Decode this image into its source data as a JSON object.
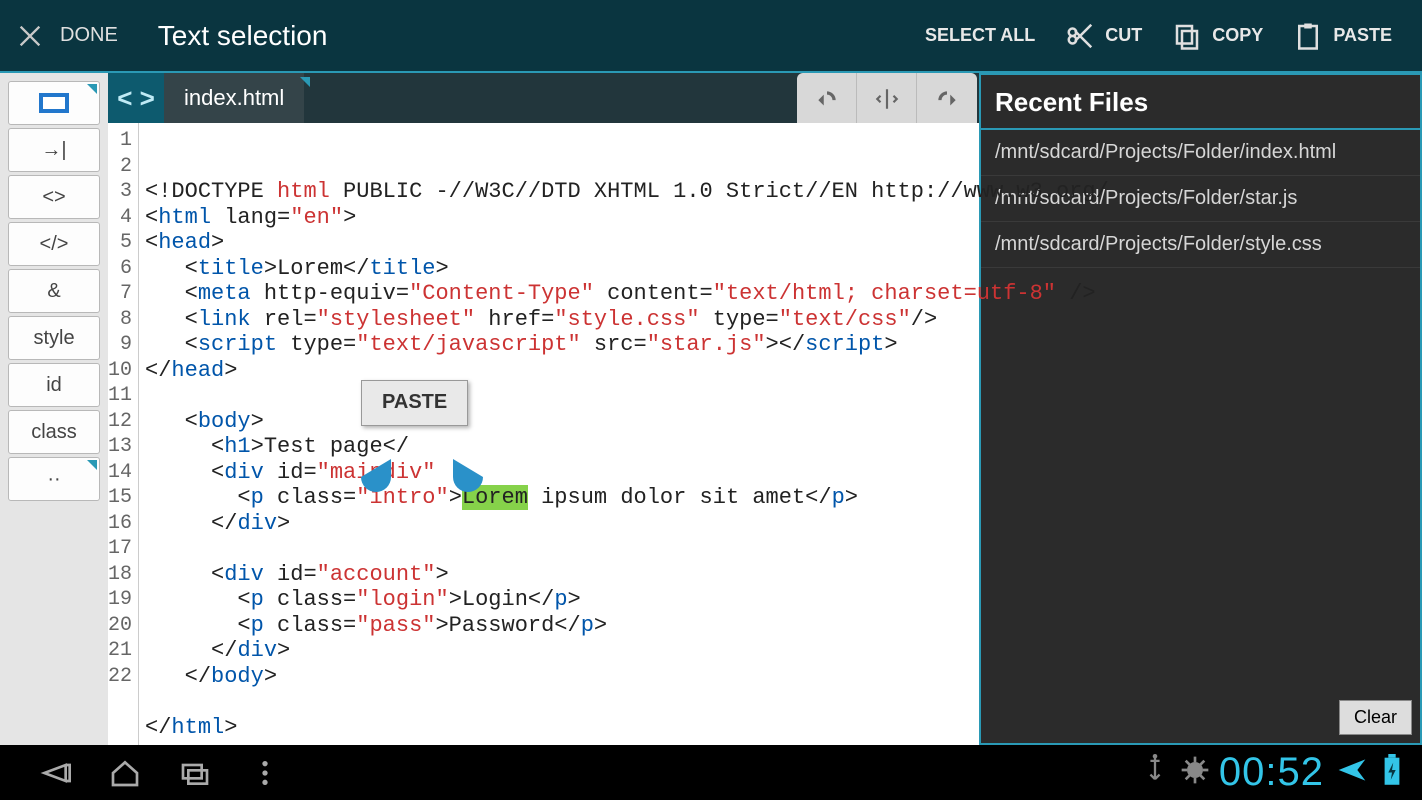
{
  "actionbar": {
    "done": "DONE",
    "title": "Text selection",
    "select_all": "SELECT ALL",
    "cut": "CUT",
    "copy": "COPY",
    "paste": "PASTE"
  },
  "left_toolbar": {
    "tab_indent": "→|",
    "angle": "<>",
    "closetag": "</>",
    "amp": "&",
    "style": "style",
    "id": "id",
    "class": "class",
    "more": "··"
  },
  "tab": {
    "filename": "index.html"
  },
  "paste_popup": "PASTE",
  "recent": {
    "title": "Recent Files",
    "items": [
      "/mnt/sdcard/Projects/Folder/index.html",
      "/mnt/sdcard/Projects/Folder/star.js",
      "/mnt/sdcard/Projects/Folder/style.css"
    ],
    "clear": "Clear"
  },
  "statusbar": {
    "time": "00:52"
  },
  "code": {
    "lines": [
      {
        "n": 1,
        "html": "&lt;!DOCTYPE <span class='kw'>html</span> PUBLIC -//W3C//DTD XHTML 1.0 Strict//EN http://www.w3.org/"
      },
      {
        "n": 2,
        "html": "&lt;<span class='tag'>html</span> lang=<span class='string'>\"en\"</span>&gt;"
      },
      {
        "n": 3,
        "html": "&lt;<span class='tag'>head</span>&gt;"
      },
      {
        "n": 4,
        "html": "   &lt;<span class='tag'>title</span>&gt;Lorem&lt;/<span class='tag'>title</span>&gt;"
      },
      {
        "n": 5,
        "html": "   &lt;<span class='tag'>meta</span> http-equiv=<span class='string'>\"Content-Type\"</span> content=<span class='string'>\"text/html; charset=utf-8\"</span> /&gt;"
      },
      {
        "n": 6,
        "html": "   &lt;<span class='tag'>link</span> rel=<span class='string'>\"stylesheet\"</span> href=<span class='string'>\"style.css\"</span> type=<span class='string'>\"text/css\"</span>/&gt;"
      },
      {
        "n": 7,
        "html": "   &lt;<span class='tag'>script</span> type=<span class='string'>\"text/javascript\"</span> src=<span class='string'>\"star.js\"</span>&gt;&lt;/<span class='tag'>script</span>&gt;"
      },
      {
        "n": 8,
        "html": "&lt;/<span class='tag'>head</span>&gt;"
      },
      {
        "n": 9,
        "html": ""
      },
      {
        "n": 10,
        "html": "   &lt;<span class='tag'>body</span>&gt;"
      },
      {
        "n": 11,
        "html": "     &lt;<span class='tag'>h1</span>&gt;Test page&lt;/"
      },
      {
        "n": 12,
        "html": "     &lt;<span class='tag'>div</span> id=<span class='string'>\"maindiv\"</span>"
      },
      {
        "n": 13,
        "html": "       &lt;<span class='tag'>p</span> class=<span class='string'>\"intro\"</span>&gt;<span class='sel'>Lorem</span> ipsum dolor sit amet&lt;/<span class='tag'>p</span>&gt;"
      },
      {
        "n": 14,
        "html": "     &lt;/<span class='tag'>div</span>&gt;"
      },
      {
        "n": 15,
        "html": ""
      },
      {
        "n": 16,
        "html": "     &lt;<span class='tag'>div</span> id=<span class='string'>\"account\"</span>&gt;"
      },
      {
        "n": 17,
        "html": "       &lt;<span class='tag'>p</span> class=<span class='string'>\"login\"</span>&gt;Login&lt;/<span class='tag'>p</span>&gt;"
      },
      {
        "n": 18,
        "html": "       &lt;<span class='tag'>p</span> class=<span class='string'>\"pass\"</span>&gt;Password&lt;/<span class='tag'>p</span>&gt;"
      },
      {
        "n": 19,
        "html": "     &lt;/<span class='tag'>div</span>&gt;"
      },
      {
        "n": 20,
        "html": "   &lt;/<span class='tag'>body</span>&gt;"
      },
      {
        "n": 21,
        "html": ""
      },
      {
        "n": 22,
        "html": "&lt;/<span class='tag'>html</span>&gt;"
      }
    ]
  }
}
